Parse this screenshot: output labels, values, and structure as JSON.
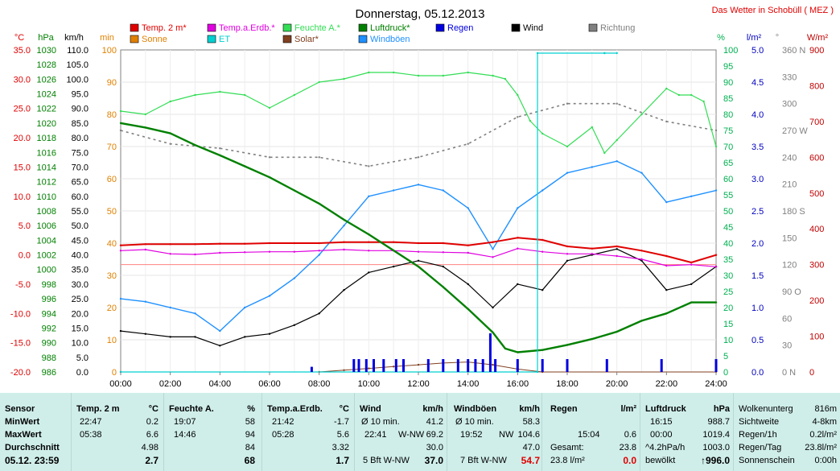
{
  "title": "Donnerstag, 05.12.2013",
  "station": "Das Wetter in Schobüll ( MEZ )",
  "chart_data": {
    "type": "line",
    "title": "Donnerstag, 05.12.2013",
    "x_ticks": [
      "00:00",
      "02:00",
      "04:00",
      "06:00",
      "08:00",
      "10:00",
      "12:00",
      "14:00",
      "16:00",
      "18:00",
      "20:00",
      "22:00",
      "24:00"
    ],
    "axes": [
      {
        "unit": "°C",
        "range": [
          -20,
          40
        ],
        "ticks": [
          "35.0",
          "30.0",
          "25.0",
          "20.0",
          "15.0",
          "10.0",
          "5.0",
          "0.0",
          "-5.0",
          "-10.0",
          "-15.0",
          "-20.0"
        ],
        "color": "#e00000"
      },
      {
        "unit": "hPa",
        "range": [
          986,
          1030
        ],
        "ticks": [
          "1030",
          "1028",
          "1026",
          "1024",
          "1022",
          "1020",
          "1018",
          "1016",
          "1014",
          "1012",
          "1010",
          "1008",
          "1006",
          "1004",
          "1002",
          "1000",
          "998",
          "996",
          "994",
          "992",
          "990",
          "988",
          "986"
        ],
        "color": "#008000"
      },
      {
        "unit": "km/h",
        "range": [
          0,
          110
        ],
        "ticks": [
          "110.0",
          "105.0",
          "100.0",
          "95.0",
          "90.0",
          "85.0",
          "80.0",
          "75.0",
          "70.0",
          "65.0",
          "60.0",
          "55.0",
          "50.0",
          "45.0",
          "40.0",
          "35.0",
          "30.0",
          "25.0",
          "20.0",
          "15.0",
          "10.0",
          "5.0",
          "0.0"
        ],
        "color": "#000000"
      },
      {
        "unit": "min",
        "range": [
          0,
          100
        ],
        "ticks": [
          "100",
          "90",
          "80",
          "70",
          "60",
          "50",
          "40",
          "30",
          "20",
          "10",
          "0"
        ],
        "color": "#e08000"
      },
      {
        "unit": "%",
        "range": [
          0,
          100
        ],
        "ticks": [
          "100",
          "95",
          "90",
          "85",
          "80",
          "75",
          "70",
          "65",
          "60",
          "55",
          "50",
          "45",
          "40",
          "35",
          "30",
          "25",
          "20",
          "15",
          "10",
          "5",
          "0"
        ],
        "color": "#00b050"
      },
      {
        "unit": "l/m²",
        "range": [
          0,
          5
        ],
        "ticks": [
          "5.0",
          "4.5",
          "4.0",
          "3.5",
          "3.0",
          "2.5",
          "2.0",
          "1.5",
          "1.0",
          "0.5",
          "0.0"
        ],
        "color": "#0000c0"
      },
      {
        "unit": "°",
        "range": [
          0,
          360
        ],
        "ticks": [
          "360 N",
          "330",
          "300",
          "270 W",
          "240",
          "210",
          "180 S",
          "150",
          "120",
          "90 O",
          "60",
          "30",
          "0 N"
        ],
        "color": "#808080"
      },
      {
        "unit": "W/m²",
        "range": [
          0,
          900
        ],
        "ticks": [
          "900",
          "800",
          "700",
          "600",
          "500",
          "400",
          "300",
          "200",
          "100",
          "0"
        ],
        "color": "#c00000"
      }
    ],
    "legend": [
      {
        "name": "Temp. 2 m*",
        "color": "#e00000"
      },
      {
        "name": "Temp.a.Erdb.*",
        "color": "#e000e0"
      },
      {
        "name": "Feuchte A.*",
        "color": "#33dd55"
      },
      {
        "name": "Luftdruck*",
        "color": "#008000"
      },
      {
        "name": "Regen",
        "color": "#0000e0"
      },
      {
        "name": "Wind",
        "color": "#000000"
      },
      {
        "name": "Richtung",
        "color": "#808080"
      },
      {
        "name": "Sonne",
        "color": "#e08000"
      },
      {
        "name": "ET",
        "color": "#00d0d0"
      },
      {
        "name": "Solar*",
        "color": "#804020"
      },
      {
        "name": "Windböen",
        "color": "#1e90ff"
      }
    ],
    "series": [
      {
        "name": "Temp. 2 m*",
        "axis": "°C",
        "x": [
          0,
          1,
          2,
          3,
          4,
          5,
          6,
          7,
          8,
          9,
          10,
          11,
          12,
          13,
          14,
          15,
          16,
          17,
          18,
          19,
          20,
          21,
          22,
          23,
          24
        ],
        "y": [
          3.6,
          3.8,
          3.8,
          3.8,
          3.9,
          3.9,
          4.0,
          4.0,
          4.0,
          4.2,
          4.2,
          4.2,
          4.0,
          4.0,
          3.6,
          4.2,
          5.0,
          4.6,
          3.4,
          3.0,
          3.4,
          2.6,
          1.6,
          0.4,
          1.8
        ]
      },
      {
        "name": "Temp.a.Erdb.*",
        "axis": "°C",
        "x": [
          0,
          1,
          2,
          3,
          4,
          5,
          6,
          7,
          8,
          9,
          10,
          11,
          12,
          13,
          14,
          15,
          16,
          17,
          18,
          19,
          20,
          21,
          22,
          23,
          24
        ],
        "y": [
          2.6,
          2.8,
          2.0,
          1.9,
          2.2,
          2.3,
          2.4,
          2.4,
          2.6,
          2.8,
          2.6,
          2.6,
          2.4,
          2.3,
          2.2,
          1.4,
          3.0,
          2.4,
          2.0,
          2.0,
          1.6,
          1.0,
          -0.2,
          0.0,
          -0.4
        ]
      },
      {
        "name": "Feuchte A.*",
        "axis": "%",
        "x": [
          0,
          1,
          2,
          3,
          4,
          5,
          6,
          7,
          8,
          9,
          10,
          11,
          12,
          13,
          14,
          15,
          15.5,
          16,
          16.5,
          17,
          18,
          19,
          19.5,
          20,
          21,
          22,
          22.5,
          23,
          23.5,
          24
        ],
        "y": [
          81,
          80,
          84,
          86,
          87,
          86,
          82,
          86,
          90,
          91,
          93,
          93,
          92,
          92,
          93,
          92,
          91,
          86,
          78,
          74,
          70,
          76,
          68,
          72,
          80,
          88,
          86,
          86,
          84,
          70
        ]
      },
      {
        "name": "Luftdruck*",
        "axis": "hPa",
        "x": [
          0,
          1,
          2,
          3,
          4,
          5,
          6,
          7,
          8,
          9,
          10,
          11,
          12,
          13,
          14,
          15,
          15.5,
          16,
          17,
          18,
          19,
          20,
          21,
          22,
          23,
          24
        ],
        "y": [
          1020.0,
          1019.4,
          1018.6,
          1017.0,
          1015.6,
          1014.1,
          1012.6,
          1010.8,
          1009.0,
          1006.8,
          1004.8,
          1002.6,
          1000.4,
          997.6,
          994.6,
          991.4,
          989.2,
          988.7,
          989.0,
          989.7,
          990.5,
          991.5,
          993.0,
          994.0,
          995.5,
          995.5
        ]
      },
      {
        "name": "Wind",
        "axis": "km/h",
        "x": [
          0,
          1,
          2,
          3,
          4,
          5,
          6,
          7,
          8,
          9,
          10,
          11,
          12,
          13,
          14,
          15,
          16,
          17,
          18,
          19,
          20,
          21,
          22,
          23,
          24
        ],
        "y": [
          14,
          13,
          12,
          12,
          9,
          12,
          13,
          16,
          20,
          28,
          34,
          36,
          38,
          36,
          30,
          22,
          30,
          28,
          38,
          40,
          42,
          38,
          28,
          30,
          36
        ]
      },
      {
        "name": "Windböen",
        "axis": "km/h",
        "x": [
          0,
          1,
          2,
          3,
          4,
          5,
          6,
          7,
          8,
          9,
          10,
          11,
          12,
          13,
          14,
          15,
          16,
          17,
          18,
          19,
          20,
          21,
          22,
          23,
          24
        ],
        "y": [
          25,
          24,
          22,
          20,
          14,
          22,
          26,
          32,
          40,
          50,
          60,
          62,
          64,
          62,
          56,
          42,
          56,
          62,
          68,
          70,
          72,
          68,
          58,
          60,
          62
        ]
      },
      {
        "name": "Richtung",
        "axis": "°",
        "x": [
          0,
          2,
          4,
          6,
          8,
          10,
          12,
          14,
          16,
          18,
          20,
          22,
          24
        ],
        "y": [
          270,
          255,
          250,
          240,
          240,
          230,
          240,
          255,
          285,
          300,
          300,
          280,
          270
        ]
      },
      {
        "name": "Solar*",
        "axis": "W/m²",
        "x": [
          0,
          8,
          9,
          10,
          11,
          12,
          13,
          14,
          15,
          16,
          17,
          24
        ],
        "y": [
          0,
          0,
          5,
          10,
          15,
          20,
          25,
          28,
          20,
          8,
          0,
          0
        ]
      },
      {
        "name": "ET",
        "axis": "l/m²",
        "x": [
          0,
          16.8,
          16.8,
          19.5,
          19.5,
          20.0
        ],
        "y": [
          0,
          0,
          4.95,
          4.95,
          4.95,
          4.95
        ]
      }
    ],
    "rain_bars": {
      "axis": "l/m²",
      "x": [
        7.7,
        9.4,
        9.6,
        9.9,
        10.2,
        10.6,
        11.1,
        11.4,
        12.4,
        13.0,
        13.6,
        14.0,
        14.3,
        14.6,
        14.9,
        15.1,
        16.0,
        17.0,
        18.0,
        19.6,
        21.8,
        24.0
      ],
      "y": [
        0.08,
        0.2,
        0.2,
        0.2,
        0.2,
        0.2,
        0.2,
        0.2,
        0.2,
        0.2,
        0.2,
        0.2,
        0.2,
        0.2,
        0.6,
        0.2,
        0.2,
        0.2,
        0.2,
        0.2,
        0.2,
        0.2
      ]
    }
  },
  "stats": {
    "sensor": {
      "h": "Sensor",
      "min": "MinWert",
      "max": "MaxWert",
      "avg": "Durchschnitt",
      "now": "05.12. 23:59"
    },
    "temp": {
      "h": "Temp. 2 m",
      "u": "°C",
      "min_t": "22:47",
      "min_v": "0.2",
      "max_t": "05:38",
      "max_v": "6.6",
      "avg": "4.98",
      "now": "2.7"
    },
    "humid": {
      "h": "Feuchte A.",
      "u": "%",
      "min_t": "19:07",
      "min_v": "58",
      "max_t": "14:46",
      "max_v": "94",
      "avg": "84",
      "now": "68"
    },
    "soil": {
      "h": "Temp.a.Erdb.",
      "u": "°C",
      "min_t": "21:42",
      "min_v": "-1.7",
      "max_t": "05:28",
      "max_v": "5.6",
      "avg": "3.32",
      "now": "1.7"
    },
    "wind": {
      "h": "Wind",
      "u": "km/h",
      "l1": "Ø 10 min.",
      "v1": "41.2",
      "l2t": "22:41",
      "l2d": "W-NW",
      "v2": "69.2",
      "avg": "30.0",
      "now_l": "5 Bft W-NW",
      "now": "37.0"
    },
    "gust": {
      "h": "Windböen",
      "u": "km/h",
      "l1": "Ø 10 min.",
      "v1": "58.3",
      "l2t": "19:52",
      "l2d": "NW",
      "v2": "104.6",
      "avg": "47.0",
      "now_l": "7 Bft W-NW",
      "now": "54.7"
    },
    "rain": {
      "h": "Regen",
      "u": "l/m²",
      "t": "15:04",
      "v": "0.6",
      "l3": "Gesamt:",
      "v3": "23.8",
      "now_l": "23.8 l/m²",
      "now": "0.0"
    },
    "press": {
      "h": "Luftdruck",
      "u": "hPa",
      "min_t": "16:15",
      "min_v": "988.7",
      "max_t": "00:00",
      "max_v": "1019.4",
      "avg_l": "^4.2hPa/h",
      "avg": "1003.0",
      "now_l": "bewölkt",
      "now": "↑996.0"
    },
    "misc": [
      {
        "l": "Wolkenunterg",
        "v": "816m"
      },
      {
        "l": "Sichtweite",
        "v": "4-8km"
      },
      {
        "l": "Regen/1h",
        "v": "0.2l/m²"
      },
      {
        "l": "Regen/Tag",
        "v": "23.8l/m²"
      },
      {
        "l": "Sonnenschein",
        "v": "0:00h"
      }
    ]
  }
}
